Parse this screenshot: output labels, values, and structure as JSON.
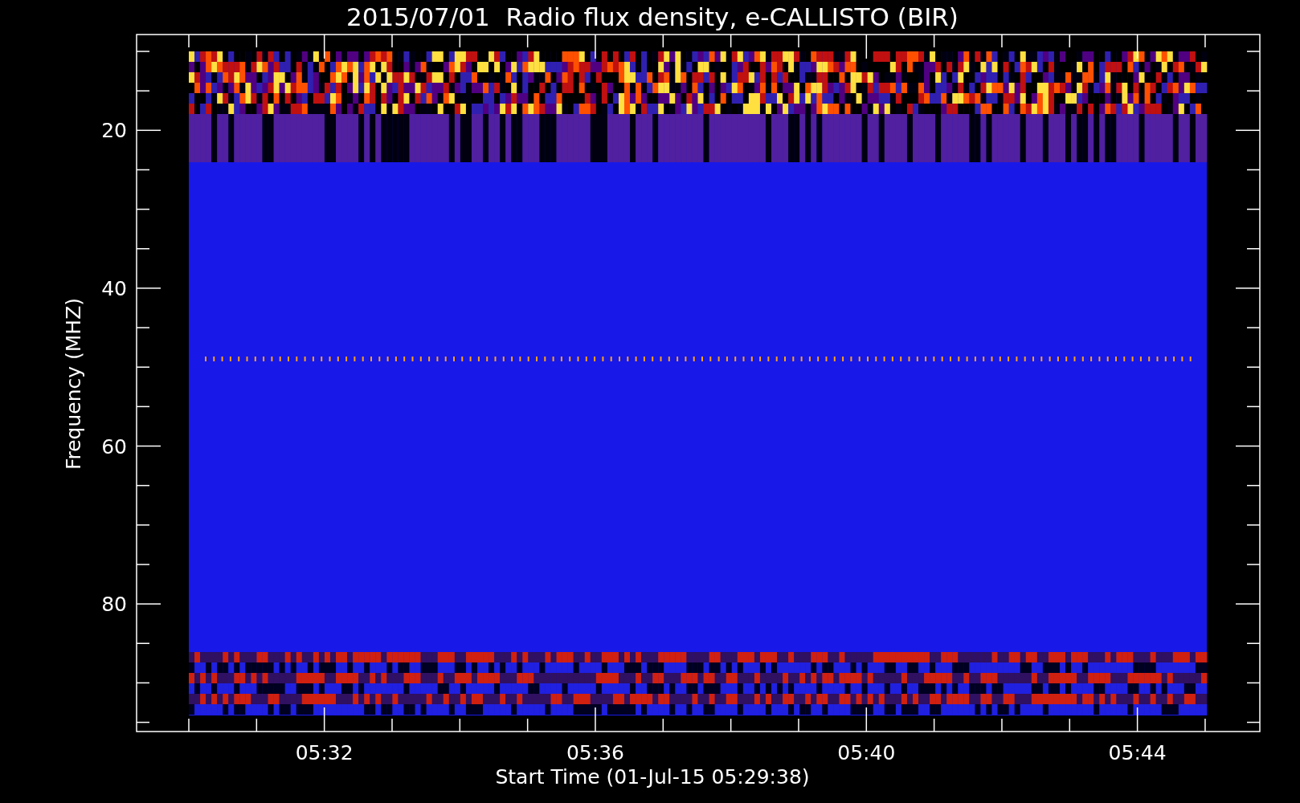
{
  "title": "2015/07/01  Radio flux density, e-CALLISTO (BIR)",
  "plot": {
    "ylabel": "Frequency (MHZ)",
    "xlabel": "Start Time (01-Jul-15 05:29:38)",
    "yticks": [
      "20",
      "40",
      "60",
      "80"
    ],
    "xticks": [
      "05:32",
      "05:36",
      "05:40",
      "05:44"
    ]
  }
}
